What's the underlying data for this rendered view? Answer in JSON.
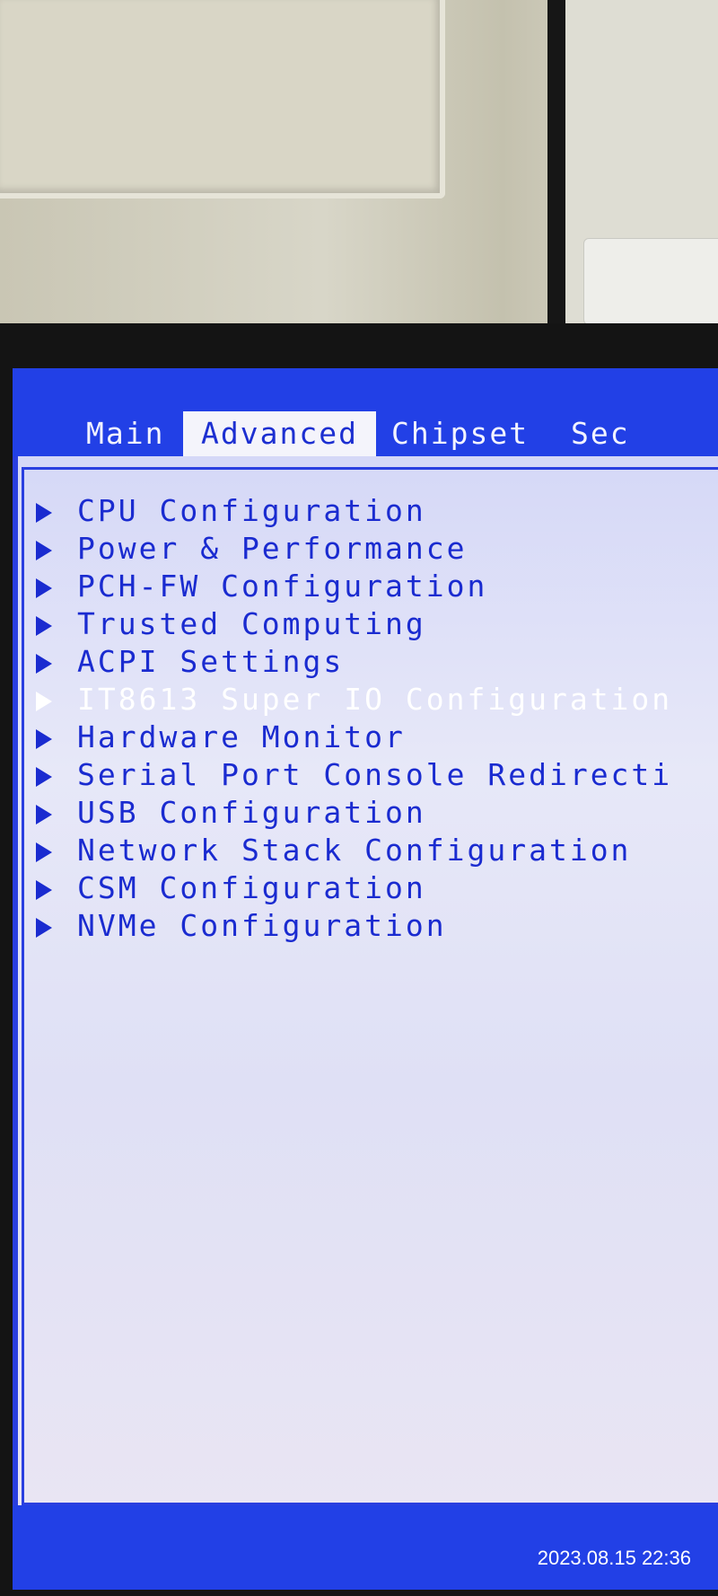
{
  "tabs": [
    {
      "label": "Main",
      "active": false
    },
    {
      "label": "Advanced",
      "active": true
    },
    {
      "label": "Chipset",
      "active": false
    },
    {
      "label": "Sec",
      "active": false
    }
  ],
  "menu": {
    "items": [
      {
        "label": "CPU Configuration",
        "selected": false
      },
      {
        "label": "Power & Performance",
        "selected": false
      },
      {
        "label": "PCH-FW Configuration",
        "selected": false
      },
      {
        "label": "Trusted Computing",
        "selected": false
      },
      {
        "label": "ACPI Settings",
        "selected": false
      },
      {
        "label": "IT8613 Super IO Configuration",
        "selected": true
      },
      {
        "label": "Hardware Monitor",
        "selected": false
      },
      {
        "label": "Serial Port Console Redirecti",
        "selected": false
      },
      {
        "label": "USB Configuration",
        "selected": false
      },
      {
        "label": "Network Stack Configuration",
        "selected": false
      },
      {
        "label": "CSM Configuration",
        "selected": false
      },
      {
        "label": "NVMe Configuration",
        "selected": false
      }
    ]
  },
  "photo_timestamp": "2023.08.15  22:36",
  "colors": {
    "bios_blue": "#2240e6",
    "panel_bg": "#dfe1f6",
    "menu_text": "#1a2bd0",
    "selected_text": "#ffffff"
  }
}
